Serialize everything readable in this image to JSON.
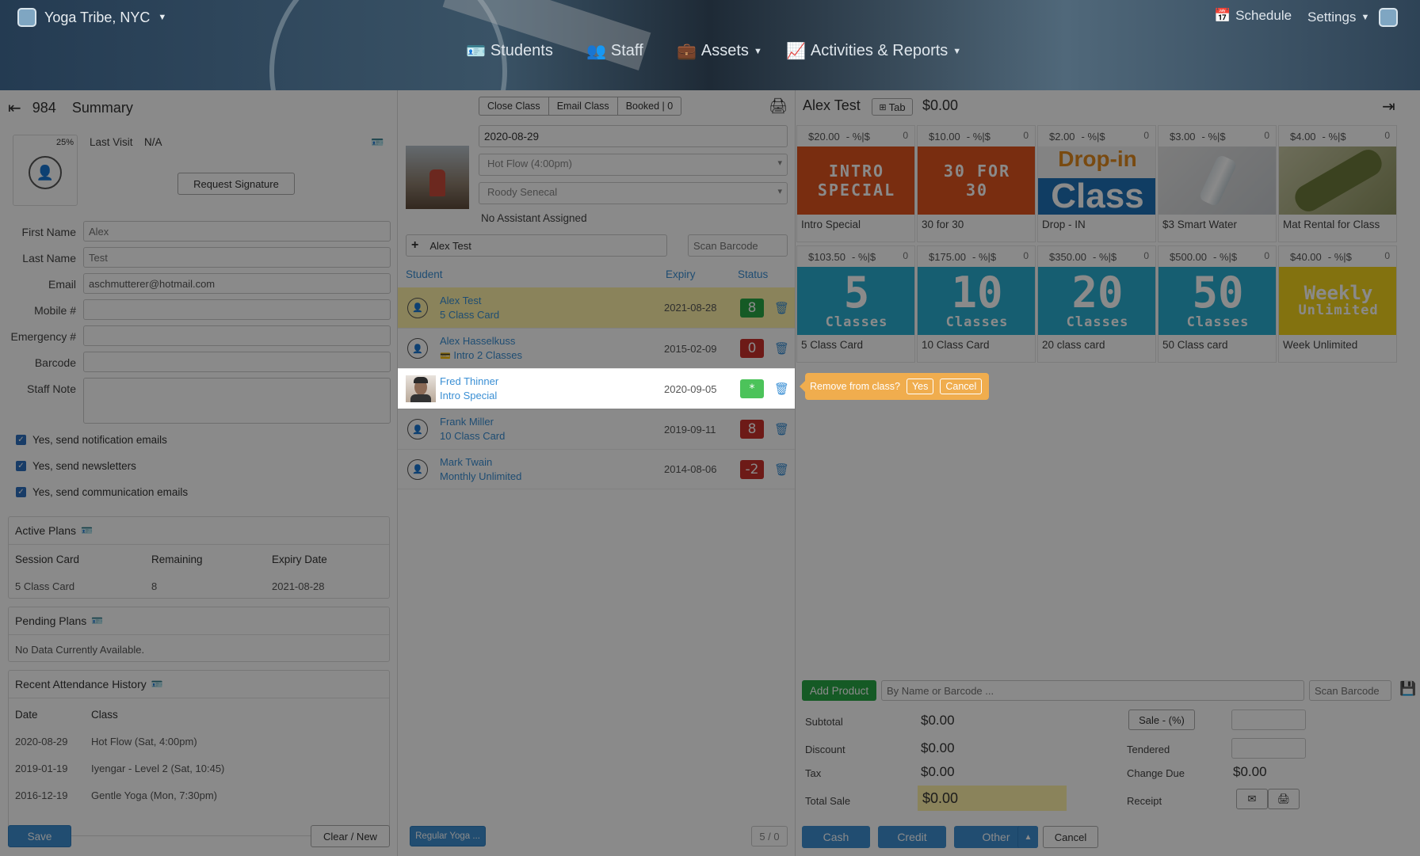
{
  "header": {
    "studio": "Yoga Tribe, NYC",
    "nav": {
      "students": "Students",
      "staff": "Staff",
      "assets": "Assets",
      "activities": "Activities & Reports"
    },
    "schedule": "Schedule",
    "settings": "Settings"
  },
  "left": {
    "id": "984",
    "title": "Summary",
    "percent": "25%",
    "last_visit_label": "Last Visit",
    "last_visit_value": "N/A",
    "request_signature": "Request Signature",
    "fields": {
      "first_name": {
        "label": "First Name",
        "placeholder": "Alex"
      },
      "last_name": {
        "label": "Last Name",
        "placeholder": "Test"
      },
      "email": {
        "label": "Email",
        "value": "aschmutterer@hotmail.com"
      },
      "mobile": {
        "label": "Mobile #"
      },
      "emergency": {
        "label": "Emergency #"
      },
      "barcode": {
        "label": "Barcode"
      },
      "staff_note": {
        "label": "Staff Note"
      }
    },
    "checks": [
      "Yes, send notification emails",
      "Yes, send newsletters",
      "Yes, send communication emails"
    ],
    "active_plans": {
      "title": "Active Plans",
      "headers": [
        "Session Card",
        "Remaining",
        "Expiry Date"
      ],
      "row": [
        "5 Class Card",
        "8",
        "2021-08-28"
      ]
    },
    "pending_plans": {
      "title": "Pending Plans",
      "empty": "No Data Currently Available."
    },
    "history": {
      "title": "Recent Attendance History",
      "headers": [
        "Date",
        "Class"
      ],
      "rows": [
        [
          "2020-08-29",
          "Hot Flow (Sat, 4:00pm)"
        ],
        [
          "2019-01-19",
          "Iyengar - Level 2 (Sat, 10:45)"
        ],
        [
          "2016-12-19",
          "Gentle Yoga (Mon, 7:30pm)"
        ]
      ]
    },
    "save": "Save",
    "clear": "Clear / New"
  },
  "middle": {
    "close_class": "Close Class",
    "email_class": "Email Class",
    "booked": "Booked | 0",
    "date": "2020-08-29",
    "class": "Hot Flow (4:00pm)",
    "instructor": "Roody Senecal",
    "assistant": "No Assistant Assigned",
    "add_student": "Alex Test",
    "scan_placeholder": "Scan Barcode",
    "headers": {
      "student": "Student",
      "expiry": "Expiry",
      "status": "Status"
    },
    "rows": [
      {
        "name": "Alex Test",
        "plan": "5 Class Card",
        "expiry": "2021-08-28",
        "status": "8"
      },
      {
        "name": "Alex Hasselkuss",
        "plan": "Intro 2 Classes",
        "expiry": "2015-02-09",
        "status": "0"
      },
      {
        "name": "Fred Thinner",
        "plan": "Intro Special",
        "expiry": "2020-09-05",
        "status": "*"
      },
      {
        "name": "Frank Miller",
        "plan": "10 Class Card",
        "expiry": "2019-09-11",
        "status": "8"
      },
      {
        "name": "Mark Twain",
        "plan": "Monthly Unlimited",
        "expiry": "2014-08-06",
        "status": "-2"
      }
    ],
    "popover": {
      "question": "Remove from class?",
      "yes": "Yes",
      "cancel": "Cancel"
    },
    "regular": "Regular Yoga ...",
    "count": "5 / 0"
  },
  "right": {
    "customer": "Alex Test",
    "tab": "Tab",
    "balance": "$0.00",
    "discount_label": "- %|$",
    "qty": "0",
    "products": [
      {
        "price": "$20.00",
        "img": "INTRO SPECIAL",
        "name": "Intro Special"
      },
      {
        "price": "$10.00",
        "img": "30 FOR 30",
        "name": "30 for 30"
      },
      {
        "price": "$2.00",
        "img": "Drop-in",
        "img2": "Class",
        "name": "Drop - IN"
      },
      {
        "price": "$3.00",
        "img": "",
        "name": "$3 Smart Water"
      },
      {
        "price": "$4.00",
        "img": "",
        "name": "Mat Rental for Class"
      },
      {
        "price": "$103.50",
        "img": "5",
        "img2": "Classes",
        "name": "5 Class Card"
      },
      {
        "price": "$175.00",
        "img": "10",
        "img2": "Classes",
        "name": "10 Class Card"
      },
      {
        "price": "$350.00",
        "img": "20",
        "img2": "Classes",
        "name": "20 class card"
      },
      {
        "price": "$500.00",
        "img": "50",
        "img2": "Classes",
        "name": "50 Class card"
      },
      {
        "price": "$40.00",
        "img": "Weekly",
        "img2": "Unlimited",
        "name": "Week Unlimited"
      }
    ],
    "add_product": "Add Product",
    "search_placeholder": "By Name or Barcode ...",
    "scan_placeholder": "Scan Barcode",
    "subtotal_label": "Subtotal",
    "subtotal": "$0.00",
    "discount_row_label": "Discount",
    "discount": "$0.00",
    "tax_label": "Tax",
    "tax": "$0.00",
    "total_label": "Total Sale",
    "total": "$0.00",
    "sale_btn": "Sale - (%)",
    "tendered": "Tendered",
    "change_label": "Change Due",
    "change": "$0.00",
    "receipt": "Receipt",
    "pay": {
      "cash": "Cash",
      "credit": "Credit",
      "other": "Other",
      "cancel": "Cancel"
    }
  },
  "colors": {
    "accent": "#3d8fd1",
    "green": "#28a745",
    "red": "#c9302c",
    "highlight": "#fff3a8",
    "popover": "#f0ad4e",
    "orange_tile": "#e0531f"
  }
}
